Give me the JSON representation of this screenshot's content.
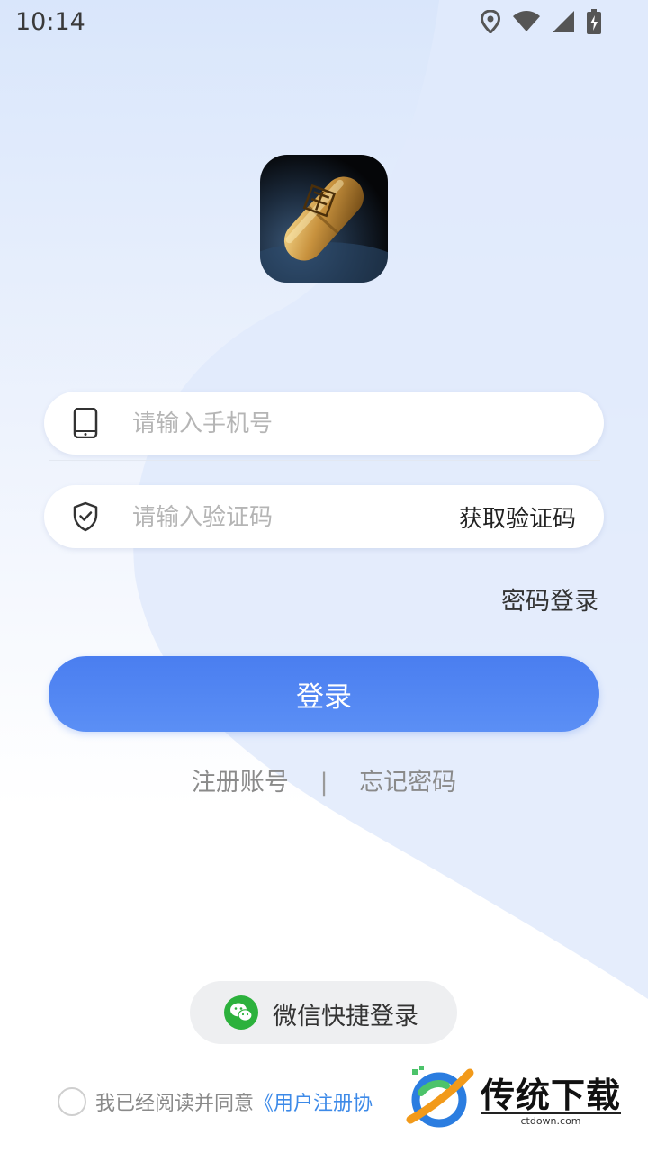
{
  "status_bar": {
    "time": "10:14"
  },
  "login": {
    "phone_placeholder": "请输入手机号",
    "code_placeholder": "请输入验证码",
    "get_code_label": "获取验证码",
    "password_login_label": "密码登录",
    "login_button_label": "登录"
  },
  "links": {
    "register": "注册账号",
    "separator": "|",
    "forgot_password": "忘记密码"
  },
  "wechat": {
    "label": "微信快捷登录"
  },
  "agreement": {
    "text": "我已经阅读并同意",
    "link": "《用户注册协"
  },
  "watermark": {
    "title": "传统下载",
    "subtitle": "ctdown.com"
  },
  "colors": {
    "primary": "#4a7ef0",
    "link": "#3d8ae8",
    "wechat_green": "#2cb13c"
  }
}
